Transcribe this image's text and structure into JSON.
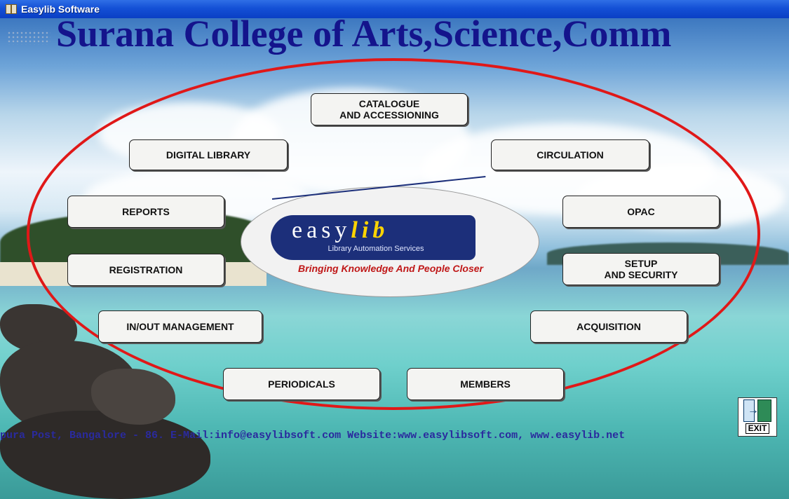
{
  "window": {
    "title": "Easylib Software"
  },
  "header": {
    "college_name": "Surana College of Arts,Science,Comm"
  },
  "modules": {
    "catalogue": "CATALOGUE\nAND ACCESSIONING",
    "digital_library": "DIGITAL LIBRARY",
    "circulation": "CIRCULATION",
    "reports": "REPORTS",
    "opac": "OPAC",
    "registration": "REGISTRATION",
    "setup_security": "SETUP\nAND SECURITY",
    "inout_management": "IN/OUT MANAGEMENT",
    "acquisition": "ACQUISITION",
    "periodicals": "PERIODICALS",
    "members": "MEMBERS"
  },
  "logo": {
    "word_plain": "easy",
    "word_highlight": "lib",
    "subtitle": "Library Automation Services",
    "tagline": "Bringing Knowledge And People Closer"
  },
  "footer": {
    "contact": "pura Post, Bangalore - 86. E-Mail:info@easylibsoft.com  Website:www.easylibsoft.com, www.easylib.net"
  },
  "exit": {
    "label": "EXIT"
  },
  "colors": {
    "title_text": "#14148c",
    "ring": "#e01818",
    "logo_navy": "#1c2f7a",
    "tagline": "#c01818",
    "footer_text": "#2a2a9e"
  }
}
